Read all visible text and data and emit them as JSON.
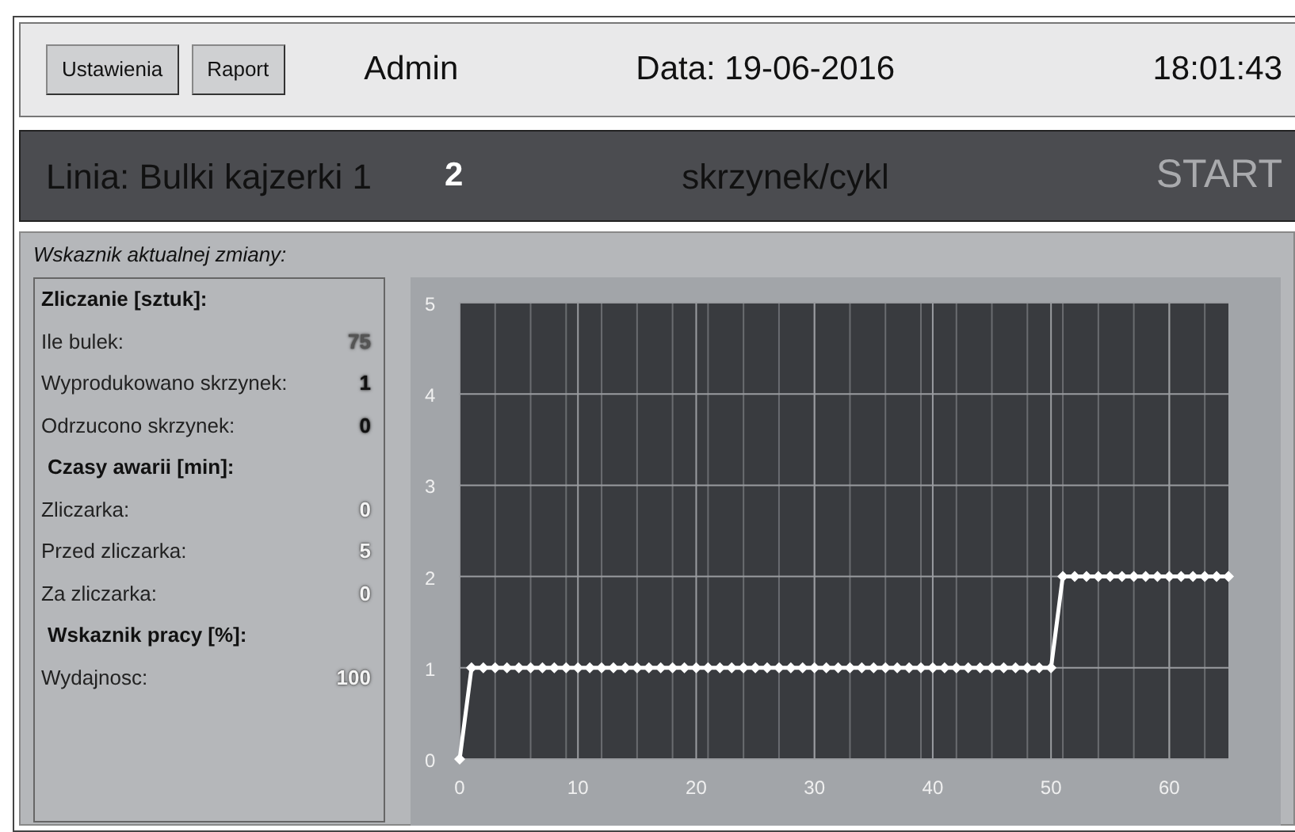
{
  "header": {
    "buttons": [
      "Ustawienia",
      "Raport"
    ],
    "user": "Admin",
    "date": "Data: 19-06-2016",
    "time": "18:01:43"
  },
  "line_bar": {
    "line": "Linia: Bulki kajzerki 1",
    "count": "2",
    "unit": "skrzynek/cykl",
    "start": {
      "label": "START",
      "disabled": true
    }
  },
  "shift_panel": {
    "title": "Wskaznik aktualnej zmiany:",
    "rows": [
      {
        "kind": "heading",
        "label": "Zliczanie [sztuk]:"
      },
      {
        "kind": "item",
        "label": "Ile bulek:",
        "value": "75",
        "color": "#555555"
      },
      {
        "kind": "item",
        "label": "Wyprodukowano skrzynek:",
        "value": "1",
        "color": "#111111"
      },
      {
        "kind": "item",
        "label": "Odrzucono skrzynek:",
        "value": "0",
        "color": "#111111"
      },
      {
        "kind": "heading",
        "label": "Czasy awarii [min]:"
      },
      {
        "kind": "item",
        "label": "Zliczarka:",
        "value": "0",
        "color": "#f4f4f4"
      },
      {
        "kind": "item",
        "label": "Przed zliczarka:",
        "value": "5",
        "color": "#f4f4f4"
      },
      {
        "kind": "item",
        "label": "Za zliczarka:",
        "value": "0",
        "color": "#f4f4f4"
      },
      {
        "kind": "heading",
        "label": "Wskaznik pracy [%]:"
      },
      {
        "kind": "item",
        "label": "Wydajnosc:",
        "value": "100",
        "color": "#f4f4f4"
      }
    ],
    "chart_data": {
      "type": "line",
      "xlim": [
        0,
        65
      ],
      "ylim": [
        0,
        5
      ],
      "xticks": [
        0,
        10,
        20,
        30,
        40,
        50,
        60
      ],
      "yticks": [
        0,
        1,
        2,
        3,
        4,
        5
      ],
      "grid": true,
      "x": [
        0,
        1,
        2,
        3,
        4,
        5,
        6,
        7,
        8,
        9,
        10,
        11,
        12,
        13,
        14,
        15,
        16,
        17,
        18,
        19,
        20,
        21,
        22,
        23,
        24,
        25,
        26,
        27,
        28,
        29,
        30,
        31,
        32,
        33,
        34,
        35,
        36,
        37,
        38,
        39,
        40,
        41,
        42,
        43,
        44,
        45,
        46,
        47,
        48,
        49,
        50,
        51,
        52,
        53,
        54,
        55,
        56,
        57,
        58,
        59,
        60,
        61,
        62,
        63,
        64,
        65
      ],
      "series": [
        {
          "color": "#ffffff",
          "marker": "diamond",
          "values": [
            0,
            1,
            1,
            1,
            1,
            1,
            1,
            1,
            1,
            1,
            1,
            1,
            1,
            1,
            1,
            1,
            1,
            1,
            1,
            1,
            1,
            1,
            1,
            1,
            1,
            1,
            1,
            1,
            1,
            1,
            1,
            1,
            1,
            1,
            1,
            1,
            1,
            1,
            1,
            1,
            1,
            1,
            1,
            1,
            1,
            1,
            1,
            1,
            1,
            1,
            1,
            2,
            2,
            2,
            2,
            2,
            2,
            2,
            2,
            2,
            2,
            2,
            2,
            2,
            2,
            2
          ]
        }
      ]
    }
  }
}
